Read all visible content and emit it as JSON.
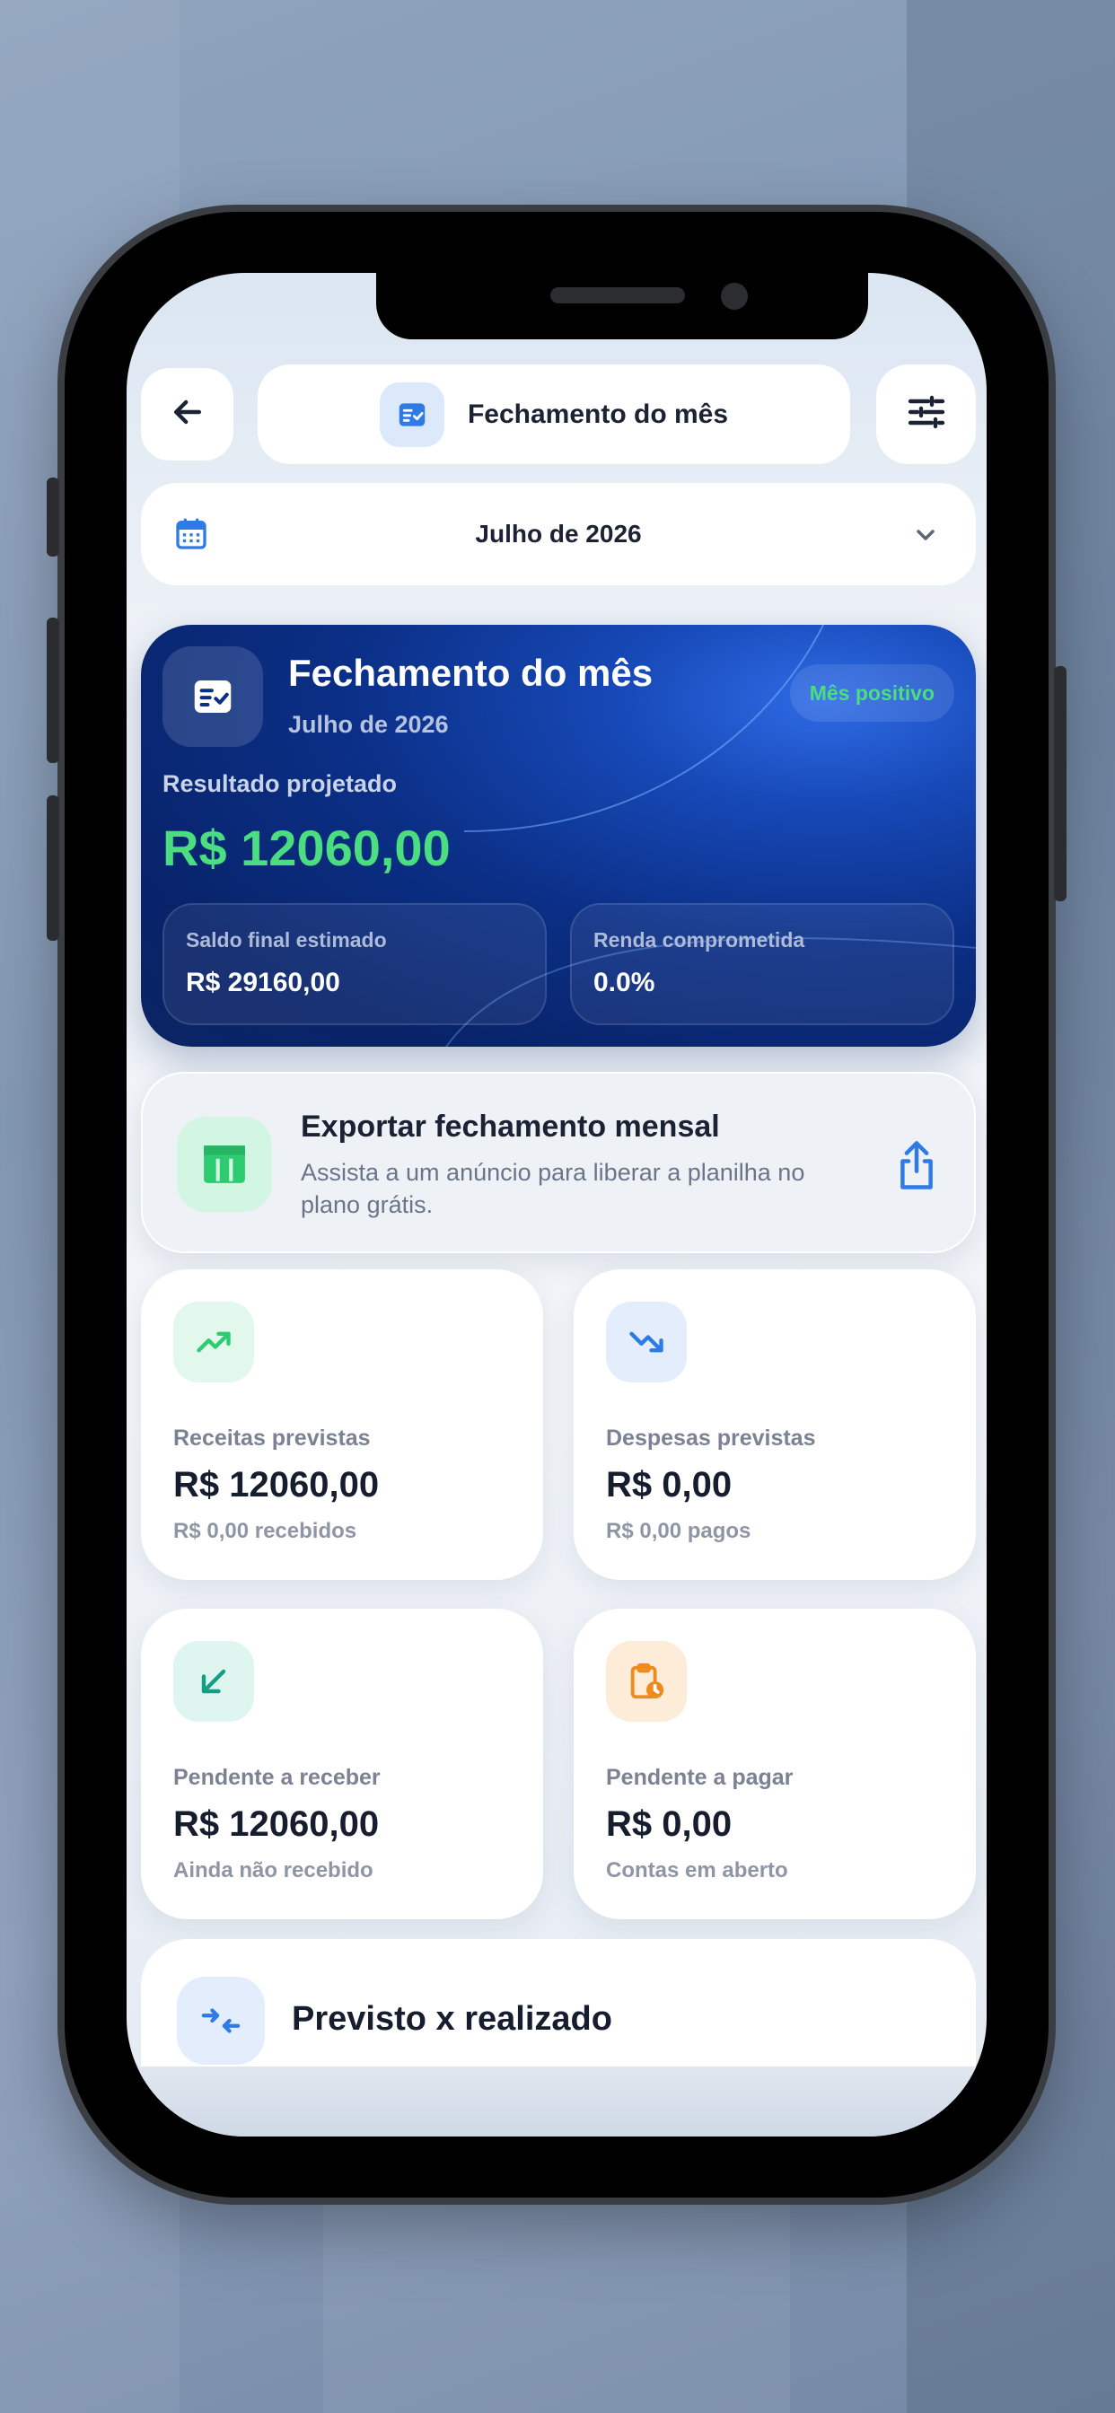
{
  "header": {
    "title": "Fechamento do mês"
  },
  "month_selector": {
    "value": "Julho de 2026"
  },
  "summary": {
    "title": "Fechamento do mês",
    "subtitle": "Julho de 2026",
    "badge": "Mês positivo",
    "result_label": "Resultado projetado",
    "result_value": "R$ 12060,00",
    "boxes": [
      {
        "label": "Saldo final estimado",
        "value": "R$ 29160,00"
      },
      {
        "label": "Renda comprometida",
        "value": "0.0%"
      }
    ]
  },
  "export": {
    "title": "Exportar fechamento mensal",
    "description": "Assista a um anúncio para liberar a planilha no plano grátis."
  },
  "stats": [
    {
      "label": "Receitas previstas",
      "value": "R$ 12060,00",
      "sub": "R$ 0,00 recebidos",
      "icon": "trending-up-icon"
    },
    {
      "label": "Despesas previstas",
      "value": "R$ 0,00",
      "sub": "R$ 0,00 pagos",
      "icon": "trending-down-icon"
    },
    {
      "label": "Pendente a receber",
      "value": "R$ 12060,00",
      "sub": "Ainda não recebido",
      "icon": "arrow-down-left-icon"
    },
    {
      "label": "Pendente a pagar",
      "value": "R$ 0,00",
      "sub": "Contas em aberto",
      "icon": "clipboard-clock-icon"
    }
  ],
  "compare": {
    "title": "Previsto x realizado"
  },
  "colors": {
    "accent_green": "#4ade80",
    "primary_blue": "#2f7be6",
    "hero_dark": "#0b2f86",
    "orange": "#f08a1c",
    "teal": "#149e86"
  }
}
